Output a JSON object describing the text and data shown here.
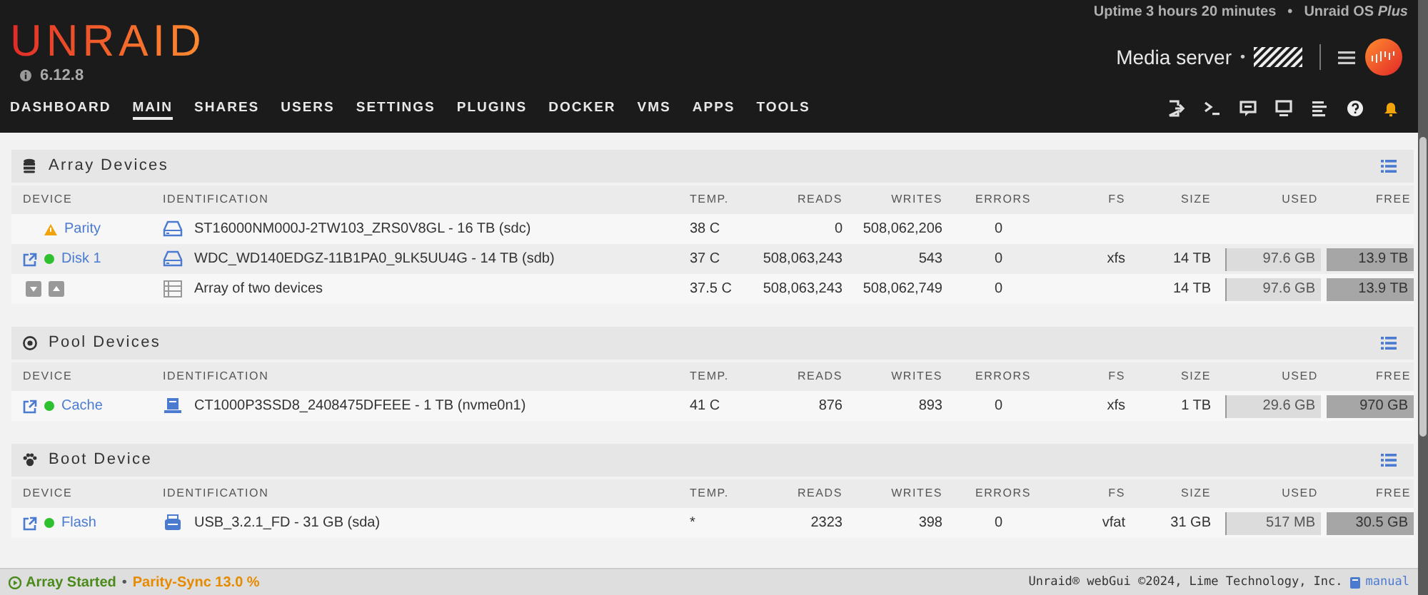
{
  "header": {
    "uptime": "Uptime 3 hours 20 minutes",
    "separator": "•",
    "license": "Unraid OS *Plus*",
    "logo": "UNRAID",
    "version": "6.12.8",
    "server_name": "Media server",
    "server_separator": "•"
  },
  "nav": [
    {
      "label": "DASHBOARD",
      "selected": false
    },
    {
      "label": "MAIN",
      "selected": true
    },
    {
      "label": "SHARES",
      "selected": false
    },
    {
      "label": "USERS",
      "selected": false
    },
    {
      "label": "SETTINGS",
      "selected": false
    },
    {
      "label": "PLUGINS",
      "selected": false
    },
    {
      "label": "DOCKER",
      "selected": false
    },
    {
      "label": "VMS",
      "selected": false
    },
    {
      "label": "APPS",
      "selected": false
    },
    {
      "label": "TOOLS",
      "selected": false
    }
  ],
  "sections": [
    {
      "title": "Array Devices",
      "columns": [
        "DEVICE",
        "IDENTIFICATION",
        "TEMP.",
        "READS",
        "WRITES",
        "ERRORS",
        "FS",
        "SIZE",
        "USED",
        "FREE"
      ],
      "rows": [
        {
          "kind": "parity",
          "device": "Parity",
          "identification": "ST16000NM000J-2TW103_ZRS0V8GL - 16 TB (sdc)",
          "temp": "38 C",
          "reads": "0",
          "writes": "508,062,206",
          "errors": "0"
        },
        {
          "kind": "disk",
          "device": "Disk 1",
          "identification": "WDC_WD140EDGZ-11B1PA0_9LK5UU4G - 14 TB (sdb)",
          "temp": "37 C",
          "reads": "508,063,243",
          "writes": "543",
          "errors": "0",
          "fs": "xfs",
          "size": "14 TB",
          "used": "97.6 GB",
          "free": "13.9 TB"
        },
        {
          "kind": "summary",
          "identification": "Array of two devices",
          "temp": "37.5 C",
          "reads": "508,063,243",
          "writes": "508,062,749",
          "errors": "0",
          "size": "14 TB",
          "used": "97.6 GB",
          "free": "13.9 TB"
        }
      ]
    },
    {
      "title": "Pool Devices",
      "columns": [
        "DEVICE",
        "IDENTIFICATION",
        "TEMP.",
        "READS",
        "WRITES",
        "ERRORS",
        "FS",
        "SIZE",
        "USED",
        "FREE"
      ],
      "rows": [
        {
          "kind": "disk",
          "device": "Cache",
          "identification": "CT1000P3SSD8_2408475DFEEE - 1 TB (nvme0n1)",
          "temp": "41 C",
          "reads": "876",
          "writes": "893",
          "errors": "0",
          "fs": "xfs",
          "size": "1 TB",
          "used": "29.6 GB",
          "free": "970 GB"
        }
      ]
    },
    {
      "title": "Boot Device",
      "columns": [
        "DEVICE",
        "IDENTIFICATION",
        "TEMP.",
        "READS",
        "WRITES",
        "ERRORS",
        "FS",
        "SIZE",
        "USED",
        "FREE"
      ],
      "rows": [
        {
          "kind": "disk",
          "device": "Flash",
          "identification": "USB_3.2.1_FD - 31 GB (sda)",
          "temp": "*",
          "reads": "2323",
          "writes": "398",
          "errors": "0",
          "fs": "vfat",
          "size": "31 GB",
          "used": "517 MB",
          "free": "30.5 GB"
        }
      ]
    }
  ],
  "status_bar": {
    "array_state": "Array Started",
    "separator": "•",
    "parity": "Parity-Sync 13.0 %",
    "copyright": "Unraid® webGui ©2024, Lime Technology, Inc.",
    "manual": "manual"
  }
}
